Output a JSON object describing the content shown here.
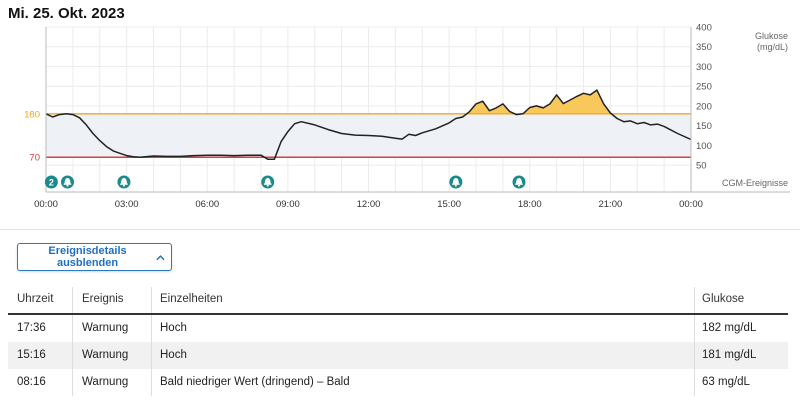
{
  "header": {
    "date": "Mi. 25. Okt. 2023"
  },
  "chart_data": {
    "type": "line",
    "title": "",
    "xlabel": "",
    "ylabel": "Glukose\n(mg/dL)",
    "xlim": [
      0,
      24
    ],
    "ylim": [
      30,
      400
    ],
    "y_axis_position": "right",
    "x_ticks": [
      "00:00",
      "03:00",
      "06:00",
      "09:00",
      "12:00",
      "15:00",
      "18:00",
      "21:00",
      "00:00"
    ],
    "y_ticks": [
      50,
      100,
      150,
      200,
      250,
      300,
      350,
      400
    ],
    "target_range": {
      "low": 70,
      "high": 180
    },
    "target_labels": [
      "180",
      "70"
    ],
    "grid": true,
    "event_row_label": "CGM-Ereignisse",
    "events": [
      {
        "time": 0.2,
        "label": "2"
      },
      {
        "time": 0.8,
        "label": ""
      },
      {
        "time": 2.9,
        "label": ""
      },
      {
        "time": 8.25,
        "label": ""
      },
      {
        "time": 15.25,
        "label": ""
      },
      {
        "time": 17.6,
        "label": ""
      }
    ],
    "x": [
      0,
      0.25,
      0.5,
      0.75,
      1,
      1.25,
      1.5,
      1.75,
      2,
      2.25,
      2.5,
      2.75,
      3,
      3.25,
      3.5,
      4,
      4.5,
      5,
      5.5,
      6,
      6.5,
      7,
      7.5,
      8,
      8.25,
      8.5,
      8.75,
      9,
      9.25,
      9.5,
      10,
      10.5,
      11,
      11.5,
      12,
      12.5,
      13,
      13.25,
      13.5,
      13.75,
      14,
      14.5,
      15,
      15.25,
      15.5,
      15.75,
      16,
      16.25,
      16.5,
      16.75,
      17,
      17.25,
      17.5,
      17.75,
      18,
      18.25,
      18.5,
      18.75,
      19,
      19.25,
      19.5,
      19.75,
      20,
      20.25,
      20.5,
      20.75,
      21,
      21.25,
      21.5,
      21.75,
      22,
      22.25,
      22.5,
      22.75,
      23,
      23.5,
      24
    ],
    "series": [
      {
        "values": [
          180,
          172,
          178,
          180,
          178,
          170,
          152,
          130,
          112,
          97,
          86,
          80,
          74,
          71,
          70,
          73,
          72,
          72,
          74,
          75,
          75,
          74,
          75,
          75,
          65,
          65,
          110,
          135,
          155,
          160,
          152,
          140,
          130,
          126,
          125,
          123,
          118,
          116,
          128,
          125,
          132,
          142,
          157,
          168,
          172,
          185,
          205,
          212,
          188,
          195,
          205,
          186,
          178,
          180,
          196,
          200,
          195,
          205,
          228,
          206,
          215,
          224,
          232,
          228,
          240,
          205,
          182,
          168,
          160,
          162,
          155,
          158,
          152,
          154,
          148,
          130,
          115
        ]
      }
    ]
  },
  "toggle": {
    "label": "Ereignisdetails ausblenden"
  },
  "table": {
    "columns": [
      "Uhrzeit",
      "Ereignis",
      "Einzelheiten",
      "Glukose"
    ],
    "rows": [
      {
        "time": "17:36",
        "type": "Warnung",
        "detail": "Hoch",
        "glucose": "182 mg/dL"
      },
      {
        "time": "15:16",
        "type": "Warnung",
        "detail": "Hoch",
        "glucose": "181 mg/dL"
      },
      {
        "time": "08:16",
        "type": "Warnung",
        "detail": "Bald niedriger Wert (dringend) – Bald",
        "glucose": "63 mg/dL"
      }
    ]
  },
  "colors": {
    "high_line": "#f5a623",
    "low_line": "#e03c3c",
    "high_fill": "#f8c95a",
    "target_band": "#eef1f5",
    "glucose_line": "#222222",
    "event_marker": "#1a8a8a"
  }
}
